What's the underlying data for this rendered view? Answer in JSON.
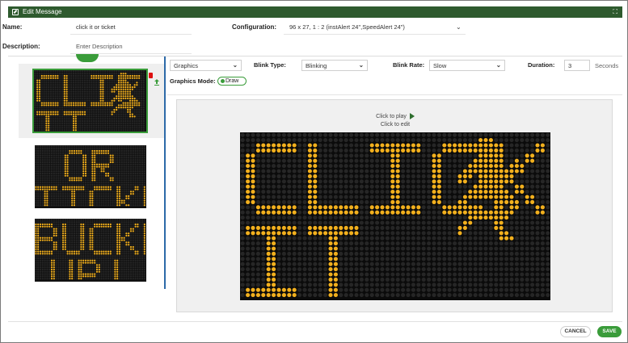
{
  "dialog": {
    "title": "Edit Message",
    "maximize_icon": "expand-icon"
  },
  "form": {
    "name_label": "Name:",
    "name_value": "click it or ticket",
    "configuration_label": "Configuration:",
    "configuration_value": "96 x 27, 1 : 2 (instAlert 24\",SpeedAlert 24\")",
    "description_label": "Description:",
    "description_placeholder": "Enter Description"
  },
  "messages": [
    {
      "lines": [
        "CLICK",
        "IT"
      ],
      "has_figure": true,
      "selected": true
    },
    {
      "lines": [
        "OR",
        "TICKET!"
      ],
      "has_figure": false,
      "selected": false
    },
    {
      "lines": [
        "BUCKLE",
        "UP!"
      ],
      "has_figure": false,
      "selected": false
    }
  ],
  "toolbar": {
    "type_value": "Graphics",
    "blink_type_label": "Blink Type:",
    "blink_type_value": "Blinking",
    "blink_rate_label": "Blink Rate:",
    "blink_rate_value": "Slow",
    "duration_label": "Duration:",
    "duration_value": "3",
    "duration_unit": "Seconds",
    "graphics_mode_label": "Graphics Mode:",
    "draw_label": "Draw"
  },
  "preview": {
    "play_hint": "Click to play",
    "edit_hint": "Click to edit",
    "sign_lines": [
      "CLICK",
      "IT"
    ],
    "led_color": "#f2b01e",
    "led_off_color": "#262626"
  },
  "footer": {
    "cancel_label": "CANCEL",
    "save_label": "SAVE"
  },
  "colors": {
    "header_green": "#2e5a2e",
    "accent_green": "#3a9c3a",
    "divider_blue": "#2d6aa8"
  }
}
